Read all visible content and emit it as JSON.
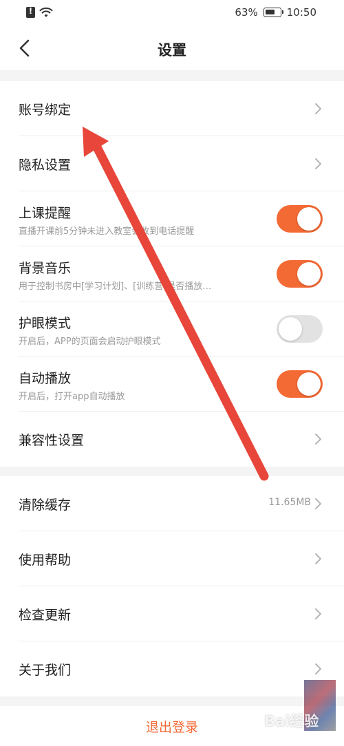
{
  "status_bar": {
    "battery": "63%",
    "time": "10:50"
  },
  "header": {
    "title": "设置"
  },
  "group1": [
    {
      "title": "账号绑定",
      "type": "link"
    },
    {
      "title": "隐私设置",
      "type": "link"
    },
    {
      "title": "上课提醒",
      "desc": "直播开课前5分钟未进入教室会收到电话提醒",
      "type": "toggle",
      "on": true
    },
    {
      "title": "背景音乐",
      "desc": "用于控制书房中[学习计划]、[训练营]是否播放…",
      "type": "toggle",
      "on": true
    },
    {
      "title": "护眼模式",
      "desc": "开启后，APP的页面会启动护眼模式",
      "type": "toggle",
      "on": false
    },
    {
      "title": "自动播放",
      "desc": "开启后，打开app自动播放",
      "type": "toggle",
      "on": true
    },
    {
      "title": "兼容性设置",
      "type": "link"
    }
  ],
  "group2": [
    {
      "title": "清除缓存",
      "value": "11.65MB",
      "type": "link"
    },
    {
      "title": "使用帮助",
      "type": "link"
    },
    {
      "title": "检查更新",
      "type": "link"
    },
    {
      "title": "关于我们",
      "type": "link"
    }
  ],
  "logout_label": "退出登录",
  "watermark": "Bai经验",
  "colors": {
    "accent": "#f36a35",
    "toggle_off": "#e2e2e2",
    "arrow": "#e8463a",
    "background": "#f4f4f4"
  },
  "icons": [
    "back-arrow-icon",
    "chevron-right-icon",
    "wifi-icon",
    "battery-icon",
    "alert-icon"
  ]
}
